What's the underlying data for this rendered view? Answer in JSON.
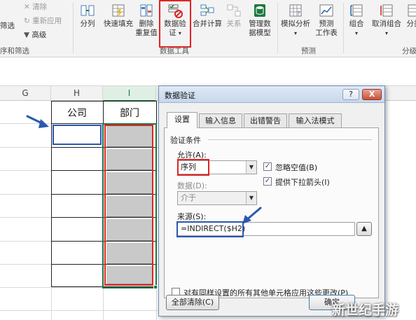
{
  "ribbon": {
    "filter_items": {
      "clear": "清除",
      "reapply": "重新应用",
      "filter": "筛选",
      "advanced": "高级"
    },
    "buttons": {
      "split": "分列",
      "flash_fill": "快速填充",
      "remove_dup_1": "删除",
      "remove_dup_2": "重复值",
      "data_validation_1": "数据验",
      "data_validation_2": "证",
      "consolidate": "合并计算",
      "relations": "关系",
      "data_model_1": "管理数",
      "data_model_2": "据模型",
      "what_if_1": "模拟分析",
      "forecast_1": "预测",
      "forecast_2": "工作表",
      "group": "组合",
      "ungroup": "取消组合",
      "subtotal": "分类"
    },
    "groups": {
      "sort_filter": "序和筛选",
      "data_tools": "数据工具",
      "forecast": "预测",
      "outline": "分级"
    }
  },
  "sheet": {
    "columns": [
      "G",
      "H",
      "I"
    ],
    "headers": {
      "company": "公司",
      "department": "部门"
    }
  },
  "dialog": {
    "title": "数据验证",
    "help": "?",
    "close": "X",
    "tabs": [
      "设置",
      "输入信息",
      "出错警告",
      "输入法模式"
    ],
    "criteria_title": "验证条件",
    "allow_label": "允许(A):",
    "allow_value": "序列",
    "ignore_blank": "忽略空值(B)",
    "dropdown": "提供下拉箭头(I)",
    "data_label": "数据(D):",
    "data_value": "介于",
    "source_label": "来源(S):",
    "source_value": "=INDIRECT($H2)",
    "apply_all": "对有同样设置的所有其他单元格应用这些更改(P)",
    "clear_all": "全部清除(C)",
    "ok": "确定"
  },
  "watermark": "新世纪手游",
  "colors": {
    "annotation_red": "#e02424",
    "annotation_blue": "#2a58b0",
    "excel_green": "#217346"
  }
}
